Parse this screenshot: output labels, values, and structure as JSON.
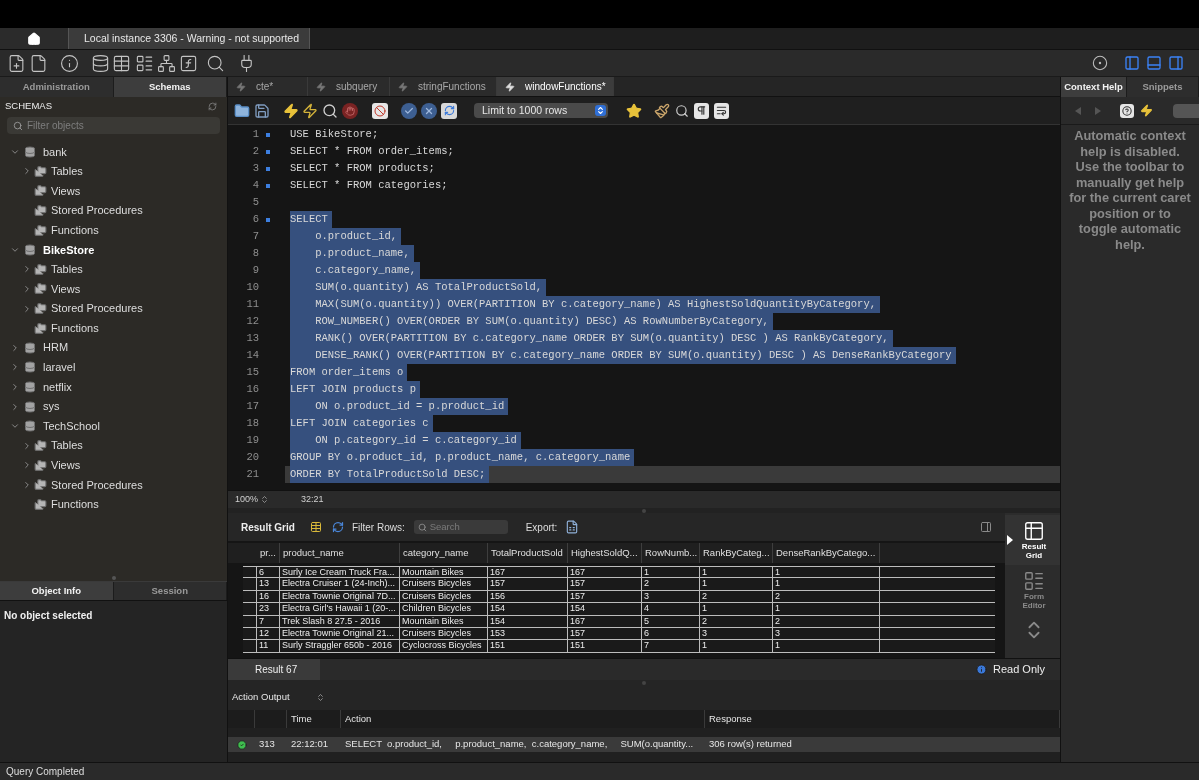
{
  "window": {
    "title": "Local instance 3306 - Warning - not supported"
  },
  "sidebar": {
    "tabs": [
      {
        "label": "Administration",
        "selected": false
      },
      {
        "label": "Schemas",
        "selected": true
      }
    ],
    "header": "SCHEMAS",
    "filter": {
      "placeholder": "Filter objects"
    },
    "schemas": [
      {
        "name": "bank",
        "default": false,
        "expanded": true,
        "children": [
          {
            "label": "Tables",
            "expandable": true
          },
          {
            "label": "Views",
            "expandable": false
          },
          {
            "label": "Stored Procedures",
            "expandable": false
          },
          {
            "label": "Functions",
            "expandable": false
          }
        ]
      },
      {
        "name": "BikeStore",
        "default": true,
        "expanded": true,
        "children": [
          {
            "label": "Tables",
            "expandable": true
          },
          {
            "label": "Views",
            "expandable": true
          },
          {
            "label": "Stored Procedures",
            "expandable": true
          },
          {
            "label": "Functions",
            "expandable": false
          }
        ]
      },
      {
        "name": "HRM",
        "default": false,
        "expanded": false
      },
      {
        "name": "laravel",
        "default": false,
        "expanded": false
      },
      {
        "name": "netflix",
        "default": false,
        "expanded": false
      },
      {
        "name": "sys",
        "default": false,
        "expanded": false
      },
      {
        "name": "TechSchool",
        "default": false,
        "expanded": true,
        "children": [
          {
            "label": "Tables",
            "expandable": true
          },
          {
            "label": "Views",
            "expandable": true
          },
          {
            "label": "Stored Procedures",
            "expandable": true
          },
          {
            "label": "Functions",
            "expandable": false
          }
        ]
      }
    ],
    "info_tabs": [
      {
        "label": "Object Info",
        "selected": true
      },
      {
        "label": "Session",
        "selected": false
      }
    ],
    "info_text": "No object selected"
  },
  "editor": {
    "tabs": [
      {
        "label": "cte*",
        "selected": false
      },
      {
        "label": "subquery",
        "selected": false
      },
      {
        "label": "stringFunctions",
        "selected": false
      },
      {
        "label": "windowFunctions*",
        "selected": true
      }
    ],
    "limit": "Limit to 1000 rows",
    "lines": [
      {
        "number": "1",
        "text": "USE BikeStore;",
        "marker": true,
        "selected": false,
        "current": false
      },
      {
        "number": "2",
        "text": "SELECT * FROM order_items;",
        "marker": true,
        "selected": false,
        "current": false
      },
      {
        "number": "3",
        "text": "SELECT * FROM products;",
        "marker": true,
        "selected": false,
        "current": false
      },
      {
        "number": "4",
        "text": "SELECT * FROM categories;",
        "marker": true,
        "selected": false,
        "current": false
      },
      {
        "number": "5",
        "marker": false,
        "selected": false,
        "current": false
      },
      {
        "number": "6",
        "text": "SELECT",
        "marker": true,
        "selected": true,
        "current": false
      },
      {
        "number": "7",
        "text": "    o.product_id,",
        "marker": false,
        "selected": true,
        "current": false
      },
      {
        "number": "8",
        "text": "    p.product_name,",
        "marker": false,
        "selected": true,
        "current": false
      },
      {
        "number": "9",
        "text": "    c.category_name,",
        "marker": false,
        "selected": true,
        "current": false
      },
      {
        "number": "10",
        "text": "    SUM(o.quantity) AS TotalProductSold,",
        "marker": false,
        "selected": true,
        "current": false
      },
      {
        "number": "11",
        "text": "    MAX(SUM(o.quantity)) OVER(PARTITION BY c.category_name) AS HighestSoldQuantityByCategory,",
        "marker": false,
        "selected": true,
        "current": false
      },
      {
        "number": "12",
        "text": "    ROW_NUMBER() OVER(ORDER BY SUM(o.quantity) DESC) AS RowNumberByCategory,",
        "marker": false,
        "selected": true,
        "current": false
      },
      {
        "number": "13",
        "text": "    RANK() OVER(PARTITION BY c.category_name ORDER BY SUM(o.quantity) DESC ) AS RankByCategory,",
        "marker": false,
        "selected": true,
        "current": false
      },
      {
        "number": "14",
        "text": "    DENSE_RANK() OVER(PARTITION BY c.category_name ORDER BY SUM(o.quantity) DESC ) AS DenseRankByCategory",
        "marker": false,
        "selected": true,
        "current": false
      },
      {
        "number": "15",
        "text": "FROM order_items o",
        "marker": false,
        "selected": true,
        "current": false
      },
      {
        "number": "16",
        "text": "LEFT JOIN products p",
        "marker": false,
        "selected": true,
        "current": false
      },
      {
        "number": "17",
        "text": "    ON o.product_id = p.product_id",
        "marker": false,
        "selected": true,
        "current": false
      },
      {
        "number": "18",
        "text": "LEFT JOIN categories c",
        "marker": false,
        "selected": true,
        "current": false
      },
      {
        "number": "19",
        "text": "    ON p.category_id = c.category_id",
        "marker": false,
        "selected": true,
        "current": false
      },
      {
        "number": "20",
        "text": "GROUP BY o.product_id, p.product_name, c.category_name",
        "marker": false,
        "selected": true,
        "current": false
      },
      {
        "number": "21",
        "text": "ORDER BY TotalProductSold DESC;",
        "marker": false,
        "selected": true,
        "current": true
      }
    ],
    "zoom": "100%",
    "position": "32:21"
  },
  "result": {
    "title": "Result Grid",
    "filter_label": "Filter Rows:",
    "search": {
      "placeholder": "Search"
    },
    "export_label": "Export:",
    "columns": [
      "pr...",
      "product_name",
      "category_name",
      "TotalProductSold",
      "HighestSoldQ...",
      "RowNumb...",
      "RankByCateg...",
      "DenseRankByCatego..."
    ],
    "rows": [
      [
        "6",
        "Surly Ice Cream Truck Fra...",
        "Mountain Bikes",
        "167",
        "167",
        "1",
        "1",
        "1"
      ],
      [
        "13",
        "Electra Cruiser 1 (24-Inch)...",
        "Cruisers Bicycles",
        "157",
        "157",
        "2",
        "1",
        "1"
      ],
      [
        "16",
        "Electra Townie Original 7D...",
        "Cruisers Bicycles",
        "156",
        "157",
        "3",
        "2",
        "2"
      ],
      [
        "23",
        "Electra Girl's Hawaii 1 (20-...",
        "Children Bicycles",
        "154",
        "154",
        "4",
        "1",
        "1"
      ],
      [
        "7",
        "Trek Slash 8 27.5 - 2016",
        "Mountain Bikes",
        "154",
        "167",
        "5",
        "2",
        "2"
      ],
      [
        "12",
        "Electra Townie Original 21...",
        "Cruisers Bicycles",
        "153",
        "157",
        "6",
        "3",
        "3"
      ],
      [
        "11",
        "Surly Straggler 650b - 2016",
        "Cyclocross Bicycles",
        "151",
        "151",
        "7",
        "1",
        "1"
      ]
    ],
    "views": [
      {
        "label": "Result Grid",
        "selected": true
      },
      {
        "label": "Form Editor",
        "selected": false
      }
    ],
    "tab": "Result 67",
    "mode": "Read Only"
  },
  "action_output": {
    "title": "Action Output",
    "columns": [
      "Time",
      "Action",
      "Response"
    ],
    "rows": [
      {
        "succeeded": true,
        "number": "313",
        "time": "22:12:01",
        "action": "SELECT  o.product_id,     p.product_name,  c.category_name,     SUM(o.quantity...",
        "response": "306 row(s) returned",
        "selected": true
      }
    ]
  },
  "context_help": {
    "tabs": [
      {
        "label": "Context Help",
        "selected": true
      },
      {
        "label": "Snippets",
        "selected": false
      }
    ],
    "text": "Automatic context help is disabled. Use the toolbar to manually get help for the current caret position or to toggle automatic help."
  },
  "status_bar": {
    "text": "Query Completed"
  }
}
